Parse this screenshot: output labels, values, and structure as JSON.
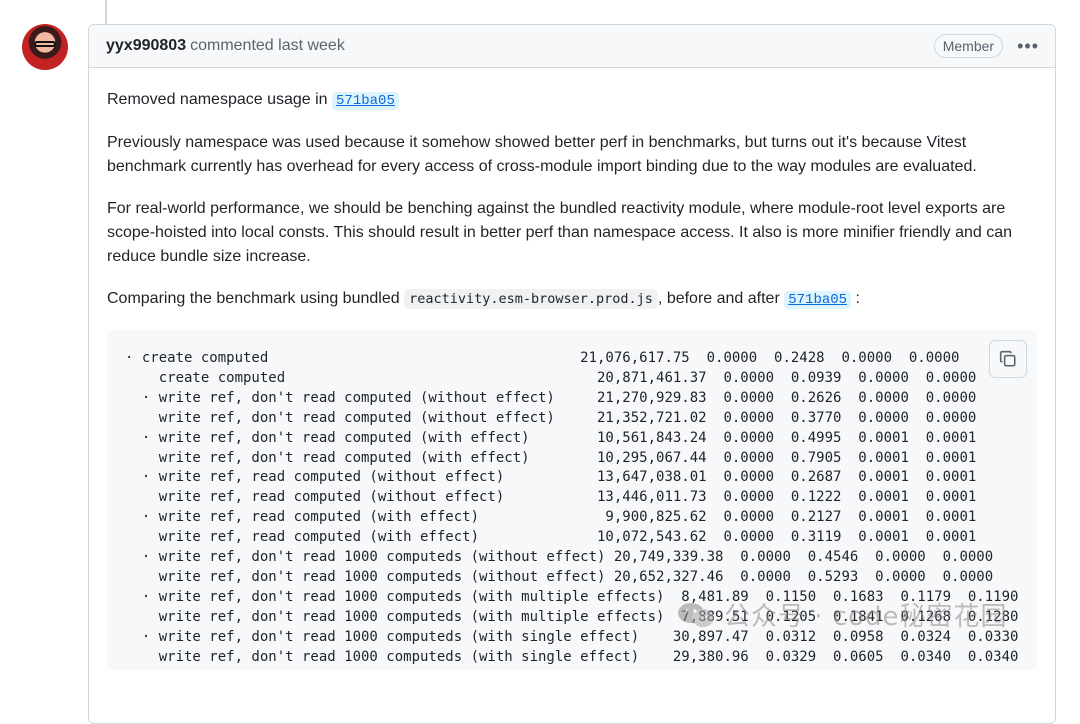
{
  "comment": {
    "author": "yyx990803",
    "meta": "commented last week",
    "badge": "Member",
    "menu_glyph": "•••",
    "p1_text": "Removed namespace usage in ",
    "commit_sha": "571ba05",
    "p2": "Previously namespace was used because it somehow showed better perf in benchmarks, but turns out it's because Vitest benchmark currently has overhead for every access of cross-module import binding due to the way modules are evaluated.",
    "p3": "For real-world performance, we should be benching against the bundled reactivity module, where module-root level exports are scope-hoisted into local consts. This should result in better perf than namespace access. It also is more minifier friendly and can reduce bundle size increase.",
    "p4_pre": "Comparing the benchmark using bundled ",
    "p4_file": "reactivity.esm-browser.prod.js",
    "p4_mid": ", before and after ",
    "p4_sha": "571ba05",
    "p4_post": " :"
  },
  "code_lines": [
    "· create computed                                     21,076,617.75  0.0000  0.2428  0.0000  0.0000",
    "    create computed                                     20,871,461.37  0.0000  0.0939  0.0000  0.0000",
    "  · write ref, don't read computed (without effect)     21,270,929.83  0.0000  0.2626  0.0000  0.0000",
    "    write ref, don't read computed (without effect)     21,352,721.02  0.0000  0.3770  0.0000  0.0000",
    "  · write ref, don't read computed (with effect)        10,561,843.24  0.0000  0.4995  0.0001  0.0001",
    "    write ref, don't read computed (with effect)        10,295,067.44  0.0000  0.7905  0.0001  0.0001",
    "  · write ref, read computed (without effect)           13,647,038.01  0.0000  0.2687  0.0001  0.0001",
    "    write ref, read computed (without effect)           13,446,011.73  0.0000  0.1222  0.0001  0.0001",
    "  · write ref, read computed (with effect)               9,900,825.62  0.0000  0.2127  0.0001  0.0001",
    "    write ref, read computed (with effect)              10,072,543.62  0.0000  0.3119  0.0001  0.0001",
    "  · write ref, don't read 1000 computeds (without effect) 20,749,339.38  0.0000  0.4546  0.0000  0.0000",
    "    write ref, don't read 1000 computeds (without effect) 20,652,327.46  0.0000  0.5293  0.0000  0.0000",
    "  · write ref, don't read 1000 computeds (with multiple effects)  8,481.89  0.1150  0.1683  0.1179  0.1190",
    "    write ref, don't read 1000 computeds (with multiple effects)  7,889.51  0.1205  0.1841  0.1268  0.1280",
    "  · write ref, don't read 1000 computeds (with single effect)    30,897.47  0.0312  0.0958  0.0324  0.0330",
    "    write ref, don't read 1000 computeds (with single effect)    29,380.96  0.0329  0.0605  0.0340  0.0340"
  ],
  "watermark": {
    "text": "公众号 · code秘密花园"
  },
  "colors": {
    "link": "#0969da",
    "border": "#d0d7de",
    "header_bg": "#f6f8fa"
  }
}
